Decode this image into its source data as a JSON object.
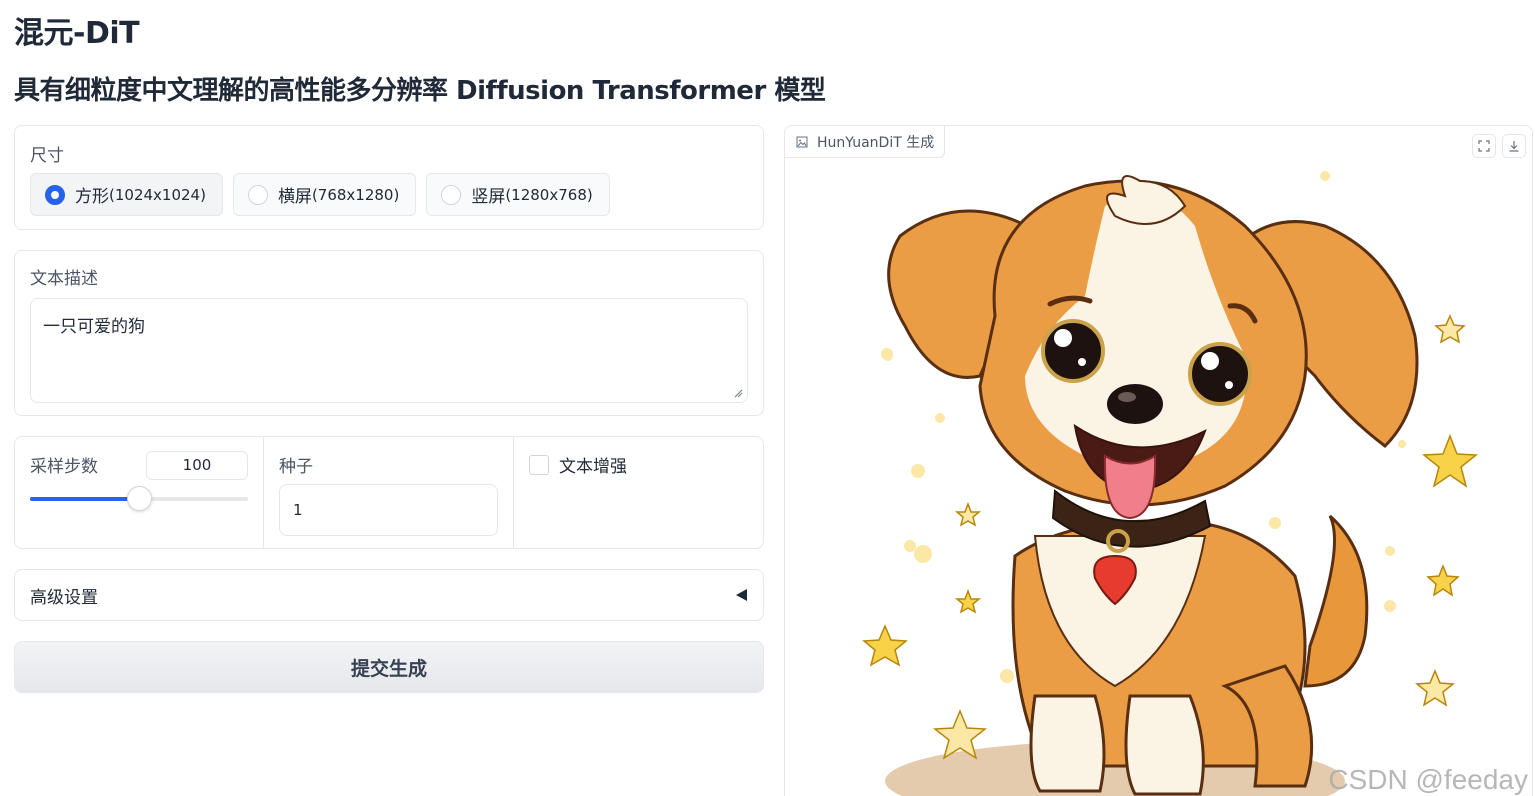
{
  "header": {
    "title": "混元-DiT",
    "subtitle": "具有细粒度中文理解的高性能多分辨率 Diffusion Transformer 模型"
  },
  "size": {
    "label": "尺寸",
    "options": [
      {
        "label": "方形",
        "dims": "(1024x1024)",
        "selected": true
      },
      {
        "label": "横屏",
        "dims": "(768x1280)",
        "selected": false
      },
      {
        "label": "竖屏",
        "dims": "(1280x768)",
        "selected": false
      }
    ]
  },
  "prompt": {
    "label": "文本描述",
    "value": "一只可爱的狗"
  },
  "steps": {
    "label": "采样步数",
    "value": "100",
    "fraction": 0.5
  },
  "seed": {
    "label": "种子",
    "value": "1"
  },
  "enhance": {
    "label": "文本增强",
    "checked": false
  },
  "advanced": {
    "label": "高级设置"
  },
  "submit": {
    "label": "提交生成"
  },
  "output": {
    "label": "HunYuanDiT 生成",
    "image_subject": "cartoon puppy with stars"
  },
  "watermark": "CSDN @feeday",
  "colors": {
    "accent": "#2563eb",
    "border": "#e5e7eb"
  }
}
